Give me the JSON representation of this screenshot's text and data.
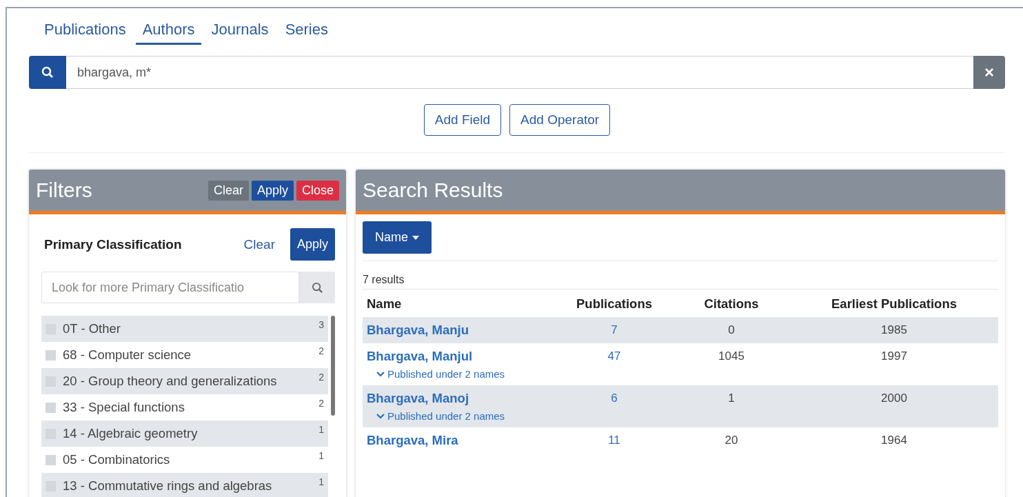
{
  "tabs": [
    {
      "label": "Publications",
      "selected": false
    },
    {
      "label": "Authors",
      "selected": true
    },
    {
      "label": "Journals",
      "selected": false
    },
    {
      "label": "Series",
      "selected": false
    }
  ],
  "search": {
    "value": "bhargava, m*",
    "clear": "×"
  },
  "query_buttons": [
    "Add Field",
    "Add Operator"
  ],
  "filters": {
    "title": "Filters",
    "buttons": [
      {
        "label": "Clear",
        "kind": "secondary"
      },
      {
        "label": "Apply",
        "kind": "primary"
      },
      {
        "label": "Close",
        "kind": "danger"
      }
    ],
    "section": {
      "title": "Primary Classification",
      "clear": "Clear",
      "apply": "Apply",
      "placeholder": "Look for more Primary Classificatio",
      "items": [
        {
          "label": "0T - Other",
          "count": "3",
          "checked": false
        },
        {
          "label": "68 - Computer science",
          "count": "2",
          "checked": false
        },
        {
          "label": "20 - Group theory and generalizations",
          "count": "2",
          "checked": false
        },
        {
          "label": "33 - Special functions",
          "count": "2",
          "checked": false
        },
        {
          "label": "14 - Algebraic geometry",
          "count": "1",
          "checked": false
        },
        {
          "label": "05 - Combinatorics",
          "count": "1",
          "checked": false
        },
        {
          "label": "13 - Commutative rings and algebras",
          "count": "1",
          "checked": false
        }
      ]
    }
  },
  "results": {
    "title": "Search Results",
    "sort": "Name",
    "count": "7 results",
    "columns": [
      "Name",
      "Publications",
      "Citations",
      "Earliest Publications"
    ],
    "rows": [
      {
        "name": "Bhargava, Manju",
        "publications": "7",
        "citations": "0",
        "earliest": "1985"
      },
      {
        "name": "Bhargava, Manjul",
        "publications": "47",
        "citations": "1045",
        "earliest": "1997",
        "aliases": "Published under 2 names"
      },
      {
        "name": "Bhargava, Manoj",
        "publications": "6",
        "citations": "1",
        "earliest": "2000",
        "aliases": "Published under 2 names"
      },
      {
        "name": "Bhargava, Mira",
        "publications": "11",
        "citations": "20",
        "earliest": "1964"
      }
    ]
  }
}
